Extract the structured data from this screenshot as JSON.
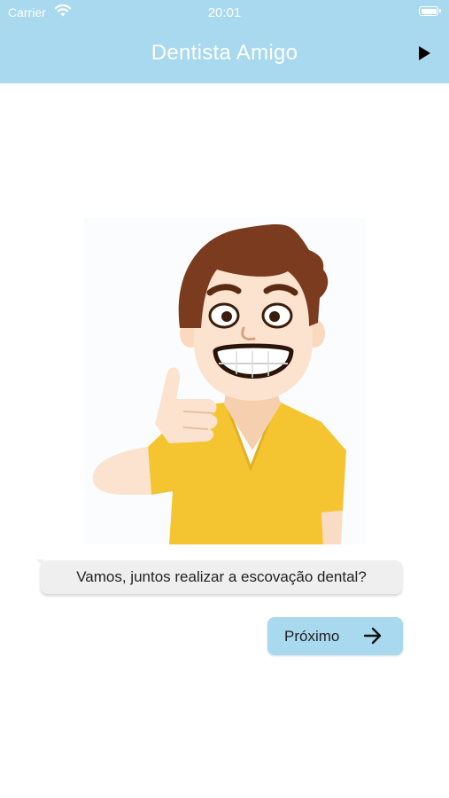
{
  "status_bar": {
    "carrier": "Carrier",
    "time": "20:01"
  },
  "app_bar": {
    "title": "Dentista Amigo",
    "action_icon": "play-icon"
  },
  "illustration": {
    "description_icon": "boy-thumbs-up-smile-illustration"
  },
  "message": {
    "text": "Vamos, juntos realizar a escovação dental?"
  },
  "next_button": {
    "label": "Próximo",
    "icon": "arrow-right-icon"
  },
  "colors": {
    "accent": "#a8d9ee",
    "bubble": "#efefef",
    "shirt": "#f5c531",
    "hair": "#7a3b1f",
    "skin": "#fbe3cf"
  }
}
